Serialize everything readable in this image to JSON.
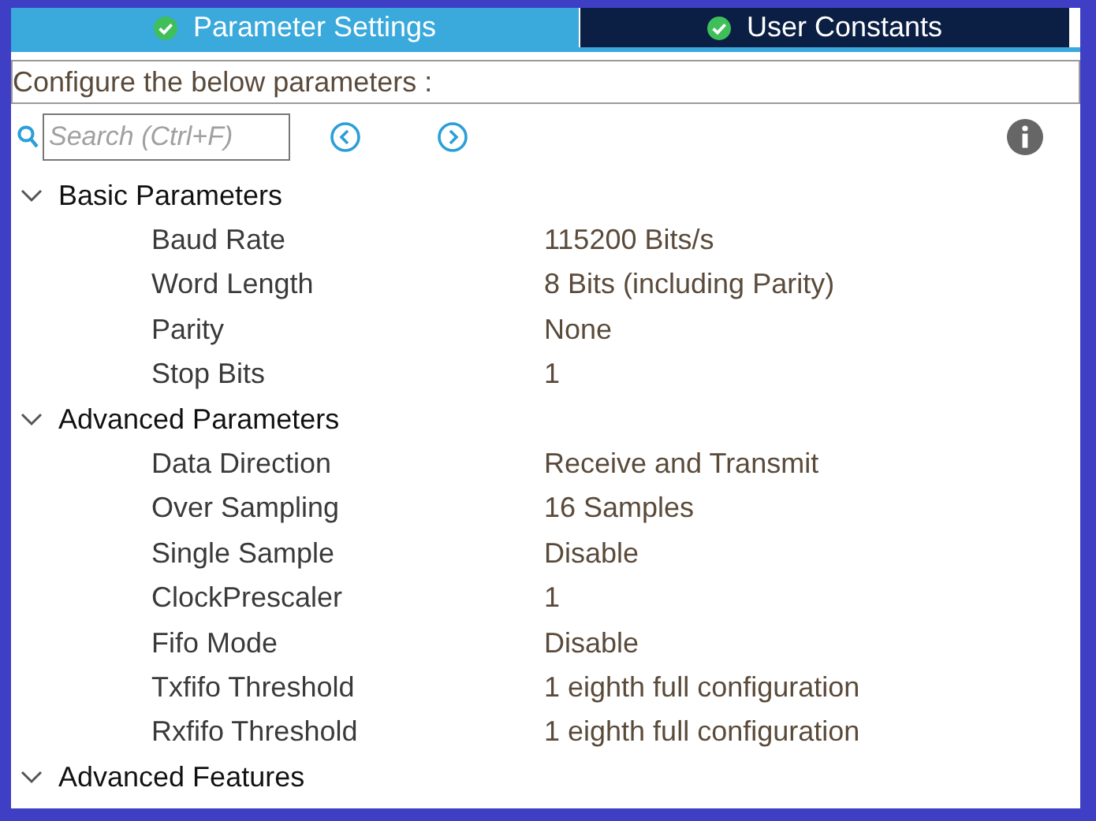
{
  "tabs": [
    {
      "label": "Parameter Settings",
      "selected": true
    },
    {
      "label": "User Constants",
      "selected": false
    }
  ],
  "description": "Configure the below parameters :",
  "search": {
    "placeholder": "Search (Ctrl+F)"
  },
  "groups": [
    {
      "label": "Basic Parameters",
      "children": [
        {
          "name": "Baud Rate",
          "value": "115200 Bits/s"
        },
        {
          "name": "Word Length",
          "value": "8 Bits (including Parity)"
        },
        {
          "name": "Parity",
          "value": "None"
        },
        {
          "name": "Stop Bits",
          "value": "1"
        }
      ]
    },
    {
      "label": "Advanced Parameters",
      "children": [
        {
          "name": "Data Direction",
          "value": "Receive and Transmit"
        },
        {
          "name": "Over Sampling",
          "value": "16 Samples"
        },
        {
          "name": "Single Sample",
          "value": "Disable"
        },
        {
          "name": "ClockPrescaler",
          "value": "1"
        },
        {
          "name": "Fifo Mode",
          "value": "Disable"
        },
        {
          "name": "Txfifo Threshold",
          "value": "1 eighth full configuration"
        },
        {
          "name": "Rxfifo Threshold",
          "value": "1 eighth full configuration"
        }
      ]
    },
    {
      "label": "Advanced Features"
    }
  ]
}
